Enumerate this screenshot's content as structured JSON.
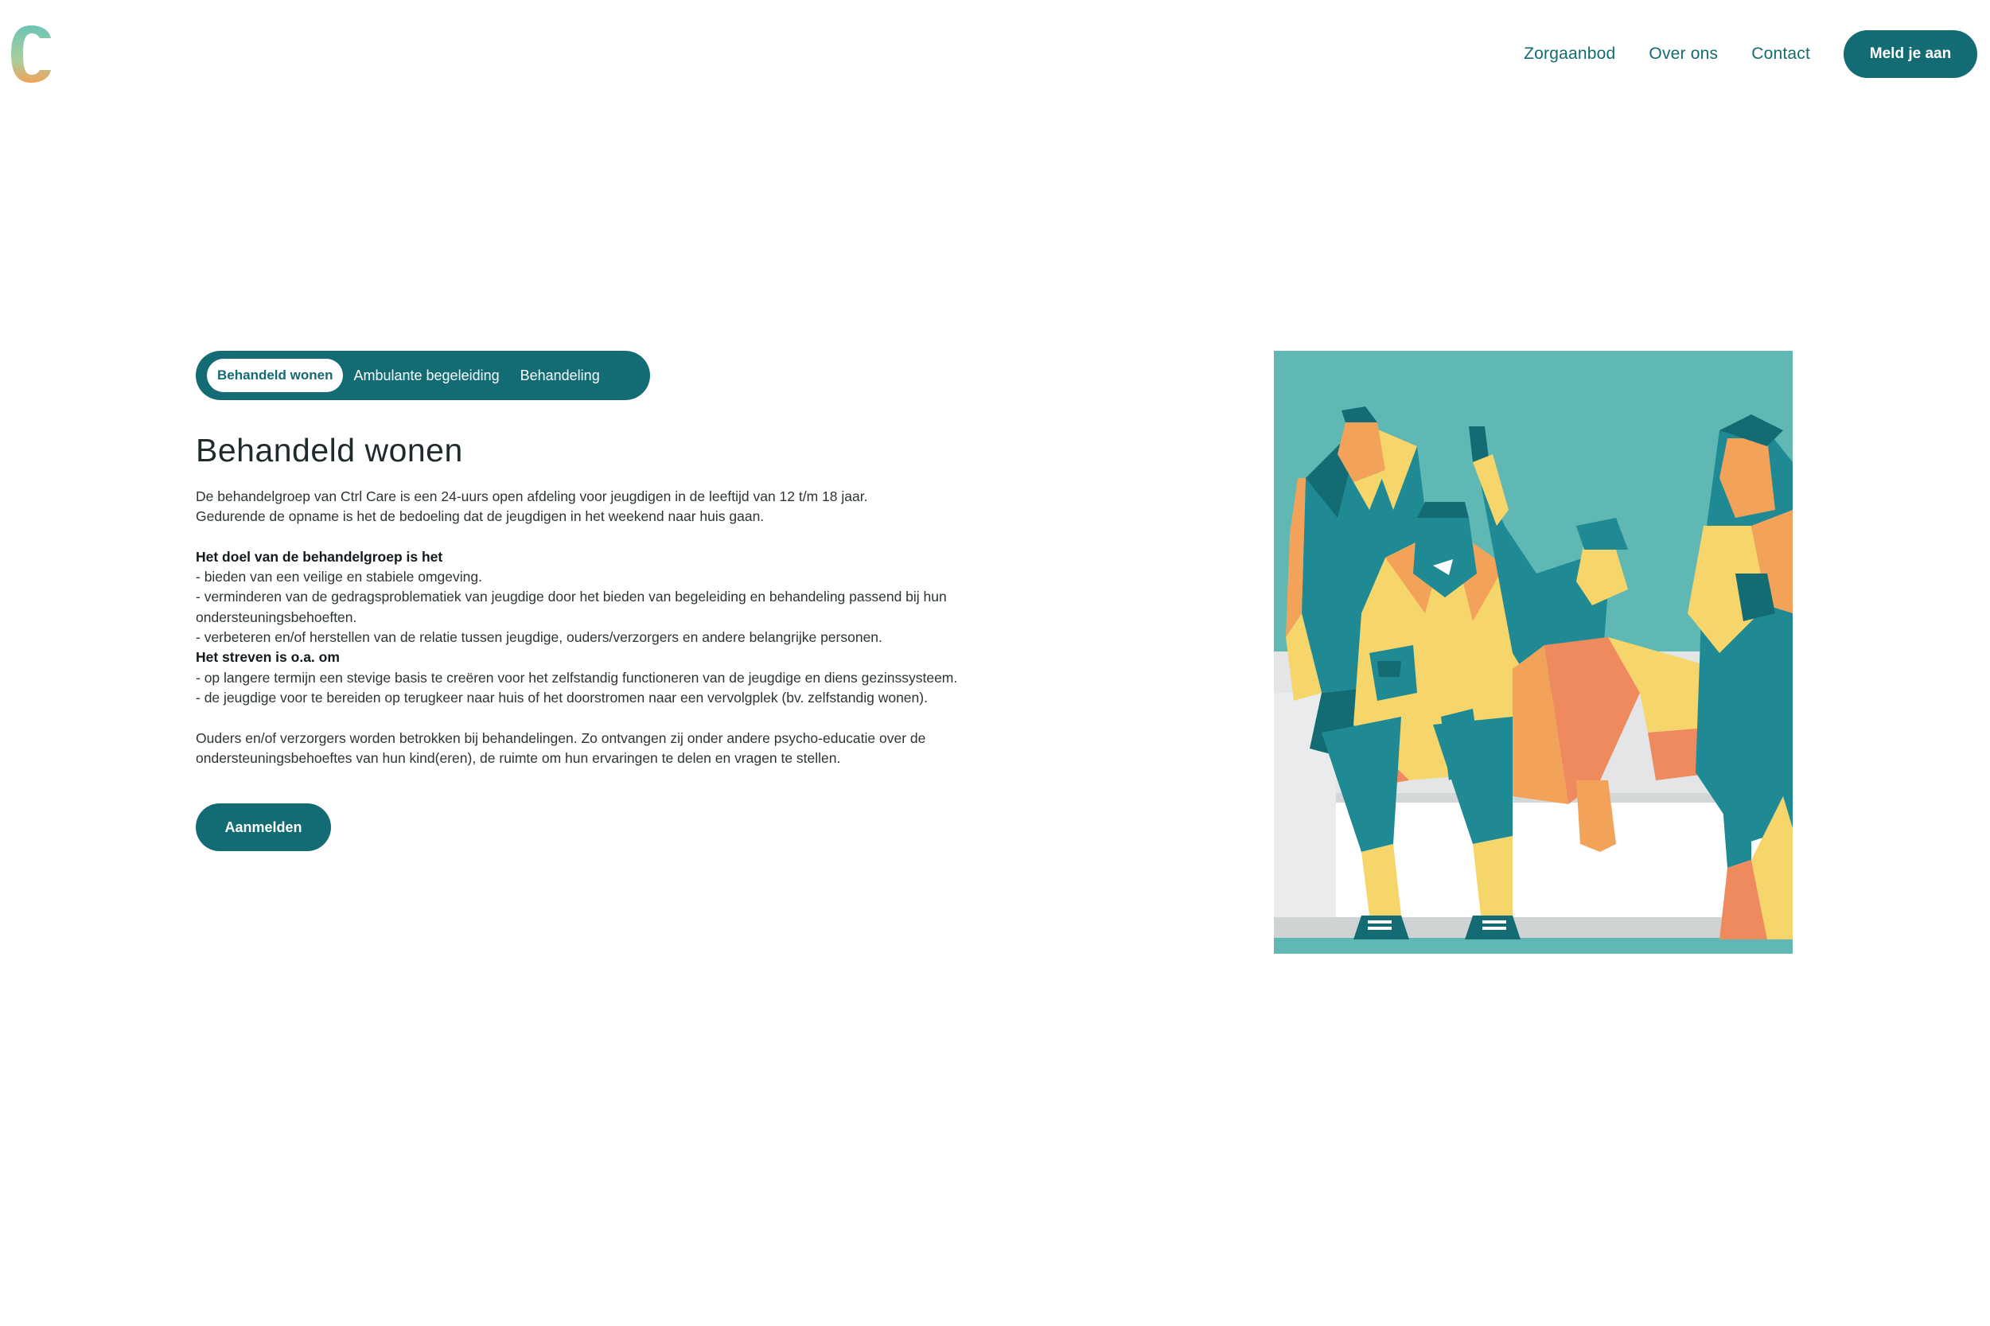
{
  "header": {
    "logo_name": "ctrl-care-logo",
    "nav": [
      {
        "label": "Zorgaanbod"
      },
      {
        "label": "Over ons"
      },
      {
        "label": "Contact"
      }
    ],
    "cta_label": "Meld je aan"
  },
  "tabs": [
    {
      "label": "Behandeld wonen",
      "active": true
    },
    {
      "label": "Ambulante begeleiding",
      "active": false
    },
    {
      "label": "Behandeling",
      "active": false
    }
  ],
  "main": {
    "title": "Behandeld wonen",
    "intro_1": "De behandelgroep van Ctrl Care is een 24-uurs open afdeling voor jeugdigen in de leeftijd van 12 t/m 18 jaar.",
    "intro_2": "Gedurende de opname is het de bedoeling dat de jeugdigen in het weekend naar huis gaan.",
    "goal_heading": "Het doel van de behandelgroep is het",
    "goal_1": "- bieden van een veilige en stabiele omgeving.",
    "goal_2": "- verminderen van de gedragsproblematiek van jeugdige door het bieden van begeleiding en behandeling passend bij hun ondersteuningsbehoeften.",
    "goal_3": "- verbeteren en/of herstellen van de relatie tussen jeugdige, ouders/verzorgers en andere belangrijke personen.",
    "aim_heading": "Het streven is o.a. om",
    "aim_1": "- op langere termijn een stevige basis te creëren voor het zelfstandig functioneren van de jeugdige en diens gezinssysteem.",
    "aim_2": "- de jeugdige voor te bereiden op terugkeer naar huis of het doorstromen naar een vervolgplek (bv. zelfstandig wonen).",
    "parents": "Ouders en/of verzorgers worden betrokken bij behandelingen. Zo ontvangen zij onder andere psycho-educatie over de ondersteuningsbehoeftes van hun kind(eren), de ruimte om hun ervaringen te delen en vragen te stellen.",
    "apply_label": "Aanmelden"
  },
  "illustration": {
    "name": "low-poly-youth-group-illustration",
    "colors": {
      "background": "#5fb8b4",
      "teal": "#1f8a93",
      "dark_teal": "#136b73",
      "yellow": "#f6d56a",
      "orange": "#f3a25a",
      "coral": "#ee8a5e",
      "bench": "#e3e5e6"
    }
  },
  "theme": {
    "accent": "#136b73",
    "logo_teal": "#5fb8b4",
    "logo_orange": "#f3a25a"
  }
}
